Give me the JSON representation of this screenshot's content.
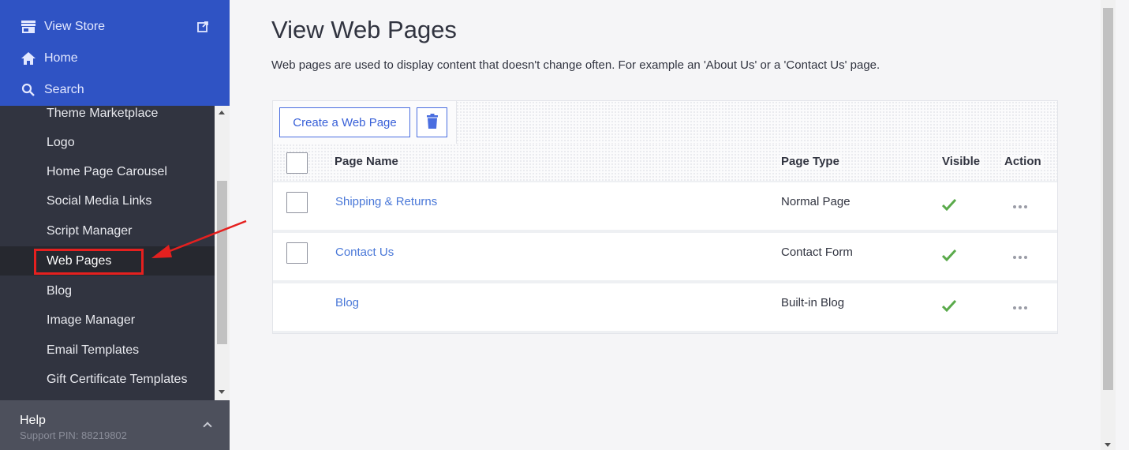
{
  "sidebar": {
    "top_items": [
      {
        "label": "View Store",
        "icon": "store-icon"
      },
      {
        "label": "Home",
        "icon": "home-icon"
      },
      {
        "label": "Search",
        "icon": "search-icon"
      }
    ],
    "items": [
      {
        "label": "Theme Marketplace"
      },
      {
        "label": "Logo"
      },
      {
        "label": "Home Page Carousel"
      },
      {
        "label": "Social Media Links"
      },
      {
        "label": "Script Manager"
      },
      {
        "label": "Web Pages"
      },
      {
        "label": "Blog"
      },
      {
        "label": "Image Manager"
      },
      {
        "label": "Email Templates"
      },
      {
        "label": "Gift Certificate Templates"
      }
    ],
    "active_item": "Web Pages",
    "help": {
      "title": "Help",
      "pin": "Support PIN: 88219802"
    }
  },
  "main": {
    "title": "View Web Pages",
    "description": "Web pages are used to display content that doesn't change often. For example an 'About Us' or a 'Contact Us' page.",
    "toolbar": {
      "create_label": "Create a Web Page",
      "delete_icon": "trash-icon"
    },
    "table": {
      "headers": {
        "name": "Page Name",
        "type": "Page Type",
        "visible": "Visible",
        "action": "Action"
      },
      "rows": [
        {
          "name": "Shipping & Returns",
          "type": "Normal Page",
          "visible": true
        },
        {
          "name": "Contact Us",
          "type": "Contact Form",
          "visible": true
        },
        {
          "name": "Blog",
          "type": "Built-in Blog",
          "visible": true
        }
      ]
    }
  },
  "colors": {
    "sidebar_top": "#2f53c4",
    "sidebar": "#313440",
    "accent": "#3860d8",
    "link": "#4a78d8",
    "check": "#5aaa4b",
    "annotation": "#e5201f"
  }
}
